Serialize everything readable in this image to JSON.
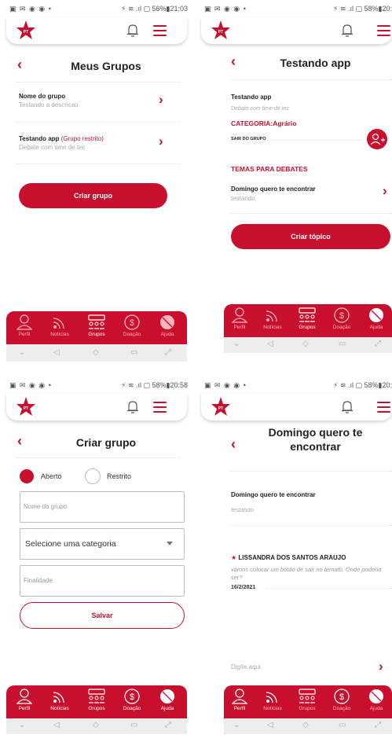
{
  "status_bars": [
    {
      "left": "▣ ✉ ◉ ◉ •",
      "right": "⚡ ≋ .ıl ▢ 56%▮21:03"
    },
    {
      "left": "▣ ✉ ◉ ◉ •",
      "right": "⚡ ≋ .ıl ▢ 58%▮20:"
    },
    {
      "left": "▣ ✉ ◉ ◉ •",
      "right": "⚡ ≋ .ıl ▢ 58%▮20:58"
    },
    {
      "left": "▣ ✉ ◉ ◉ •",
      "right": "⚡ ≋ .ıl ▢ 58%▮20:"
    }
  ],
  "logo_text": "PT",
  "nav": {
    "perfil": "Perfil",
    "noticias": "Notícias",
    "grupos": "Grupos",
    "doacao": "Doação",
    "ajuda": "Ajuda"
  },
  "screen1": {
    "title": "Meus Grupos",
    "groups": [
      {
        "name": "Nome do grupo",
        "tag": "",
        "desc": "Testando a descricao"
      },
      {
        "name": "Testando app",
        "tag": "(Grupo restrito)",
        "desc": "Debate com time de tec"
      }
    ],
    "create_button": "Criar grupo"
  },
  "screen2": {
    "title": "Testando app",
    "group_name": "Testando app",
    "group_desc": "Debate com time de tec",
    "category": "CATEGORIA:Agrário",
    "leave": "SAIR DO GRUPO",
    "topics_header": "TEMAS PARA DEBATES",
    "topic_title": "Domingo quero te encontrar",
    "topic_sub": "testando",
    "create_topic": "Criar tópico"
  },
  "screen3": {
    "title": "Criar grupo",
    "radio_open": "Aberto",
    "radio_restricted": "Restrito",
    "name_placeholder": "Nome do grupo",
    "category_select": "Selecione uma categoria",
    "purpose_placeholder": "Finalidade",
    "save": "Salvar"
  },
  "screen4": {
    "title_line1": "Domingo quero te",
    "title_line2": "encontrar",
    "topic_title": "Domingo quero te encontrar",
    "topic_sub": "testando",
    "author": "LISSANDRA DOS SANTOS ARAUJO",
    "comment": "vamos colocar um botão de sair no tematb. Onde poderia ser?",
    "date": "16/2/2021",
    "input_placeholder": "Digite aqui"
  },
  "colors": {
    "brand": "#c8102e"
  }
}
